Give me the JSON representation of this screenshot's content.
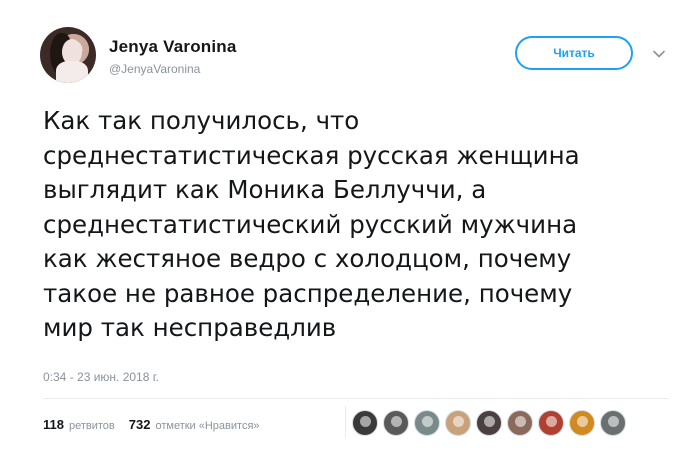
{
  "user": {
    "name": "Jenya Varonina",
    "handle": "@JenyaVaronina"
  },
  "follow_button": "Читать",
  "icons": {
    "avatar": "user-avatar",
    "caret": "chevron-down-icon"
  },
  "tweet": {
    "text": "Как так получилось, что\nсреднестатистическая русская женщина\nвыглядит как Моника Беллуччи, а\nсреднестатистический русский мужчина\nкак жестяное ведро с холодцом, почему\nтакое не равное распределение, почему\nмир так несправедлив",
    "timestamp": "0:34 - 23 июн. 2018 г."
  },
  "stats": {
    "retweets_count": "118",
    "retweets_label": "ретвитов",
    "likes_count": "732",
    "likes_label": "отметки «Нравится»"
  },
  "likers": [
    {
      "color": "#3a3a3a"
    },
    {
      "color": "#5a5a5a"
    },
    {
      "color": "#7a8a8a"
    },
    {
      "color": "#c9a27a"
    },
    {
      "color": "#4a4040"
    },
    {
      "color": "#8a6a5a"
    },
    {
      "color": "#b04030"
    },
    {
      "color": "#d08a20"
    },
    {
      "color": "#6a7070"
    }
  ],
  "colors": {
    "accent": "#1da1f2",
    "text": "#14171a",
    "muted": "#8a939b"
  }
}
